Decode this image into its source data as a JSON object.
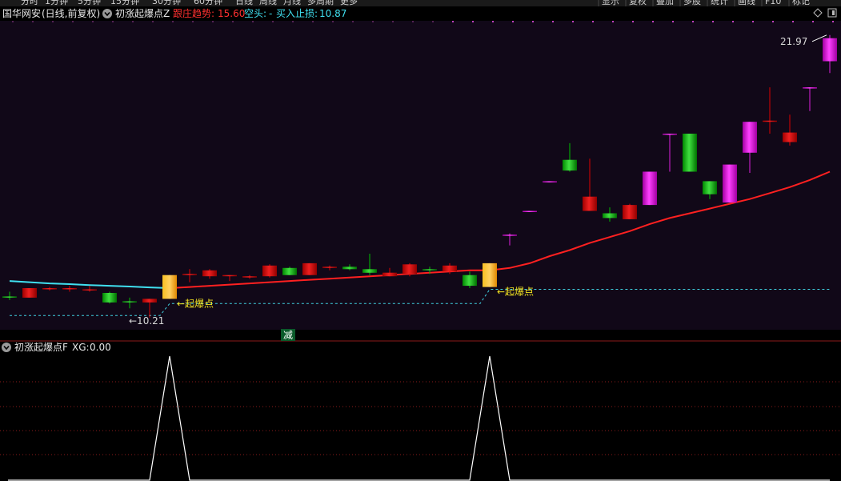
{
  "toolbar": {
    "left_items": [
      "分时",
      "1分钟",
      "5分钟",
      "15分钟",
      "30分钟",
      "60分钟",
      "日线",
      "周线",
      "月线",
      "多周期",
      "更多"
    ],
    "right_items": [
      "显示",
      "复权",
      "叠加",
      "多股",
      "统计",
      "画线",
      "F10",
      "标记"
    ]
  },
  "main_panel": {
    "stock": "国华网安",
    "period": "(日线,前复权)",
    "indicator_name": "初涨起爆点Z",
    "follow_label": "跟庄趋势:",
    "follow_value": "15.60",
    "short_label": "空头:",
    "short_value": "-",
    "stop_label": "买入止损:",
    "stop_value": "10.87",
    "low_label": "←10.21",
    "high_label": "21.97",
    "signal_text": "←起爆点",
    "reduce_text": "减"
  },
  "sub_panel": {
    "indicator_name": "初涨起爆点F",
    "xg_label": "XG:",
    "xg_value": "0.00"
  },
  "colors": {
    "up_candle": "#e00000",
    "down_candle": "#00c000",
    "magenta_candle": "#e020e0",
    "signal_candle": "#f0a000",
    "trend_line": "#ff2020",
    "cyan_line": "#40e0f0",
    "stop_line": "#40d0e0",
    "xg_line": "#ffffff",
    "background_main": "#110818",
    "grid_dot": "#8b1a1a"
  },
  "chart_data": [
    {
      "type": "candlestick",
      "title": "初涨起爆点Z",
      "ylim": [
        9.7,
        22.7
      ],
      "candles": [
        {
          "o": 11.1,
          "h": 11.3,
          "l": 10.95,
          "c": 11.1,
          "kind": "down"
        },
        {
          "o": 11.05,
          "h": 11.45,
          "l": 11.05,
          "c": 11.45,
          "kind": "up"
        },
        {
          "o": 11.4,
          "h": 11.5,
          "l": 11.35,
          "c": 11.45,
          "kind": "up"
        },
        {
          "o": 11.4,
          "h": 11.55,
          "l": 11.3,
          "c": 11.45,
          "kind": "up"
        },
        {
          "o": 11.4,
          "h": 11.55,
          "l": 11.3,
          "c": 11.4,
          "kind": "up"
        },
        {
          "o": 11.25,
          "h": 11.3,
          "l": 10.8,
          "c": 10.85,
          "kind": "down"
        },
        {
          "o": 10.9,
          "h": 11.05,
          "l": 10.6,
          "c": 10.9,
          "kind": "down"
        },
        {
          "o": 10.85,
          "h": 11.0,
          "l": 10.21,
          "c": 11.0,
          "kind": "up"
        },
        {
          "o": 11.0,
          "h": 12.0,
          "l": 11.0,
          "c": 12.0,
          "kind": "signal"
        },
        {
          "o": 12.0,
          "h": 12.25,
          "l": 11.7,
          "c": 12.05,
          "kind": "up"
        },
        {
          "o": 11.95,
          "h": 12.25,
          "l": 11.85,
          "c": 12.2,
          "kind": "up"
        },
        {
          "o": 11.95,
          "h": 12.0,
          "l": 11.75,
          "c": 12.0,
          "kind": "up"
        },
        {
          "o": 11.95,
          "h": 12.0,
          "l": 11.85,
          "c": 11.95,
          "kind": "up"
        },
        {
          "o": 11.95,
          "h": 12.45,
          "l": 11.9,
          "c": 12.4,
          "kind": "up"
        },
        {
          "o": 12.3,
          "h": 12.35,
          "l": 12.0,
          "c": 12.0,
          "kind": "down"
        },
        {
          "o": 12.0,
          "h": 12.5,
          "l": 12.0,
          "c": 12.5,
          "kind": "up"
        },
        {
          "o": 12.3,
          "h": 12.4,
          "l": 12.2,
          "c": 12.35,
          "kind": "up"
        },
        {
          "o": 12.35,
          "h": 12.45,
          "l": 12.2,
          "c": 12.25,
          "kind": "down"
        },
        {
          "o": 12.25,
          "h": 12.9,
          "l": 12.0,
          "c": 12.1,
          "kind": "down"
        },
        {
          "o": 11.95,
          "h": 12.3,
          "l": 11.95,
          "c": 12.1,
          "kind": "up"
        },
        {
          "o": 12.05,
          "h": 12.5,
          "l": 11.95,
          "c": 12.45,
          "kind": "up"
        },
        {
          "o": 12.25,
          "h": 12.35,
          "l": 12.05,
          "c": 12.25,
          "kind": "down"
        },
        {
          "o": 12.15,
          "h": 12.5,
          "l": 12.05,
          "c": 12.4,
          "kind": "up"
        },
        {
          "o": 12.0,
          "h": 12.15,
          "l": 11.45,
          "c": 11.55,
          "kind": "down"
        },
        {
          "o": 11.5,
          "h": 12.5,
          "l": 11.5,
          "c": 12.5,
          "kind": "signal"
        },
        {
          "o": 13.7,
          "h": 13.75,
          "l": 13.25,
          "c": 13.7,
          "kind": "magenta"
        },
        {
          "o": 14.7,
          "h": 14.7,
          "l": 14.7,
          "c": 14.7,
          "kind": "magenta"
        },
        {
          "o": 15.95,
          "h": 15.95,
          "l": 15.95,
          "c": 15.95,
          "kind": "magenta"
        },
        {
          "o": 16.85,
          "h": 17.55,
          "l": 16.35,
          "c": 16.4,
          "kind": "down"
        },
        {
          "o": 14.7,
          "h": 16.9,
          "l": 14.7,
          "c": 15.3,
          "kind": "up"
        },
        {
          "o": 14.6,
          "h": 14.85,
          "l": 14.25,
          "c": 14.4,
          "kind": "down"
        },
        {
          "o": 14.35,
          "h": 15.0,
          "l": 14.35,
          "c": 14.95,
          "kind": "up"
        },
        {
          "o": 14.95,
          "h": 16.35,
          "l": 14.95,
          "c": 16.35,
          "kind": "magenta"
        },
        {
          "o": 17.95,
          "h": 17.95,
          "l": 16.35,
          "c": 17.95,
          "kind": "magenta"
        },
        {
          "o": 17.95,
          "h": 17.95,
          "l": 16.35,
          "c": 16.35,
          "kind": "down"
        },
        {
          "o": 15.95,
          "h": 15.95,
          "l": 15.2,
          "c": 15.4,
          "kind": "down"
        },
        {
          "o": 15.05,
          "h": 16.65,
          "l": 15.05,
          "c": 16.65,
          "kind": "magenta"
        },
        {
          "o": 17.15,
          "h": 18.45,
          "l": 16.3,
          "c": 18.45,
          "kind": "magenta"
        },
        {
          "o": 18.45,
          "h": 19.9,
          "l": 17.95,
          "c": 18.5,
          "kind": "up"
        },
        {
          "o": 17.6,
          "h": 18.75,
          "l": 17.45,
          "c": 18.0,
          "kind": "up"
        },
        {
          "o": 19.9,
          "h": 19.9,
          "l": 18.9,
          "c": 19.9,
          "kind": "magenta"
        },
        {
          "o": 21.0,
          "h": 22.1,
          "l": 20.5,
          "c": 21.97,
          "kind": "magenta"
        }
      ],
      "trend_line": [
        null,
        null,
        null,
        null,
        null,
        null,
        null,
        null,
        11.45,
        11.5,
        11.55,
        11.6,
        11.65,
        11.7,
        11.75,
        11.8,
        11.85,
        11.9,
        11.95,
        12.0,
        12.05,
        12.1,
        12.15,
        12.2,
        12.2,
        12.3,
        12.5,
        12.8,
        13.05,
        13.35,
        13.6,
        13.85,
        14.15,
        14.4,
        14.6,
        14.8,
        15.0,
        15.2,
        15.45,
        15.7,
        16.0,
        16.35
      ],
      "cyan_line": [
        11.75,
        11.7,
        11.65,
        11.62,
        11.58,
        11.55,
        11.52,
        11.48,
        11.45
      ],
      "stop_line": [
        10.3,
        10.3,
        10.3,
        10.3,
        10.3,
        10.3,
        10.3,
        10.3,
        10.8,
        10.8,
        10.8,
        10.8,
        10.8,
        10.8,
        10.8,
        10.8,
        10.8,
        10.8,
        10.8,
        10.8,
        10.8,
        10.8,
        10.8,
        10.8,
        11.4,
        11.4,
        11.4,
        11.4,
        11.4,
        11.4,
        11.4,
        11.4,
        11.4,
        11.4,
        11.4,
        11.4,
        11.4,
        11.4,
        11.4,
        11.4,
        11.4,
        11.4
      ],
      "signals": [
        8,
        24
      ],
      "low_index": 7,
      "high_index": 41
    },
    {
      "type": "line",
      "title": "初涨起爆点F",
      "series": [
        {
          "name": "XG",
          "values": [
            0,
            0,
            0,
            0,
            0,
            0,
            0,
            0,
            1,
            0,
            0,
            0,
            0,
            0,
            0,
            0,
            0,
            0,
            0,
            0,
            0,
            0,
            0,
            0,
            1,
            0,
            0,
            0,
            0,
            0,
            0,
            0,
            0,
            0,
            0,
            0,
            0,
            0,
            0,
            0,
            0,
            0
          ]
        }
      ],
      "ylim": [
        0,
        1
      ]
    }
  ]
}
